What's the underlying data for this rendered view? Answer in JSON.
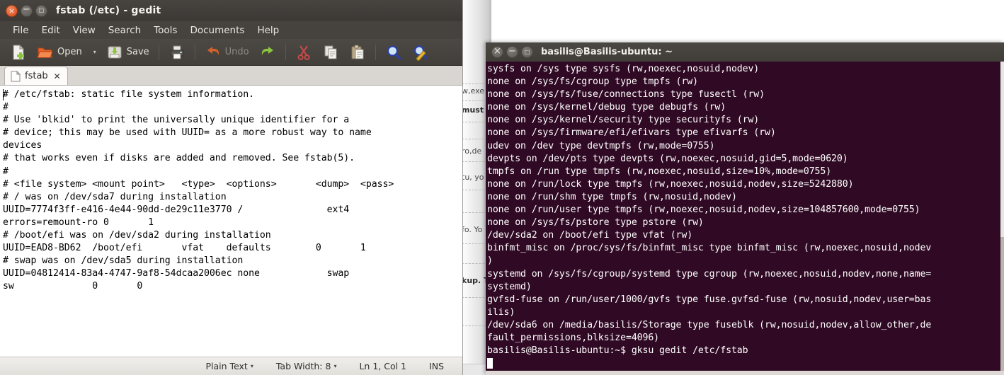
{
  "gedit": {
    "title": "fstab (/etc) - gedit",
    "window_buttons": [
      {
        "name": "close",
        "glyph": "×"
      },
      {
        "name": "minimize",
        "glyph": "−"
      },
      {
        "name": "maximize",
        "glyph": "□"
      }
    ],
    "menu": [
      "File",
      "Edit",
      "View",
      "Search",
      "Tools",
      "Documents",
      "Help"
    ],
    "toolbar": {
      "new_label": "",
      "open_label": "Open",
      "open_dropdown": "▾",
      "save_label": "Save",
      "print_label": "",
      "undo_label": "Undo",
      "redo_label": "",
      "cut_label": "",
      "copy_label": "",
      "paste_label": "",
      "find_label": "",
      "replace_label": ""
    },
    "tab": {
      "label": "fstab",
      "close": "✕"
    },
    "document_text": "# /etc/fstab: static file system information.\n#\n# Use 'blkid' to print the universally unique identifier for a\n# device; this may be used with UUID= as a more robust way to name\ndevices\n# that works even if disks are added and removed. See fstab(5).\n#\n# <file system> <mount point>   <type>  <options>       <dump>  <pass>\n# / was on /dev/sda7 during installation\nUUID=7774f3ff-e416-4e44-90dd-de29c11e3770 /               ext4\nerrors=remount-ro 0       1\n# /boot/efi was on /dev/sda2 during installation\nUUID=EAD8-BD62  /boot/efi       vfat    defaults        0       1\n# swap was on /dev/sda5 during installation\nUUID=04812414-83a4-4747-9af8-54dcaa2006ec none            swap\nsw              0       0",
    "statusbar": {
      "language": "Plain Text",
      "language_arrow": "▾",
      "tab_width": "Tab Width: 8",
      "tab_width_arrow": "▾",
      "position": "Ln 1, Col 1",
      "mode": "INS"
    }
  },
  "terminal": {
    "title": "basilis@Basilis-ubuntu: ~",
    "window_buttons": [
      {
        "name": "close",
        "glyph": "×"
      },
      {
        "name": "minimize",
        "glyph": "−"
      },
      {
        "name": "maximize",
        "glyph": "□"
      }
    ],
    "output": "sysfs on /sys type sysfs (rw,noexec,nosuid,nodev)\nnone on /sys/fs/cgroup type tmpfs (rw)\nnone on /sys/fs/fuse/connections type fusectl (rw)\nnone on /sys/kernel/debug type debugfs (rw)\nnone on /sys/kernel/security type securityfs (rw)\nnone on /sys/firmware/efi/efivars type efivarfs (rw)\nudev on /dev type devtmpfs (rw,mode=0755)\ndevpts on /dev/pts type devpts (rw,noexec,nosuid,gid=5,mode=0620)\ntmpfs on /run type tmpfs (rw,noexec,nosuid,size=10%,mode=0755)\nnone on /run/lock type tmpfs (rw,noexec,nosuid,nodev,size=5242880)\nnone on /run/shm type tmpfs (rw,nosuid,nodev)\nnone on /run/user type tmpfs (rw,noexec,nosuid,nodev,size=104857600,mode=0755)\nnone on /sys/fs/pstore type pstore (rw)\n/dev/sda2 on /boot/efi type vfat (rw)\nbinfmt_misc on /proc/sys/fs/binfmt_misc type binfmt_misc (rw,noexec,nosuid,nodev\n)\nsystemd on /sys/fs/cgroup/systemd type cgroup (rw,noexec,nosuid,nodev,none,name=\nsystemd)\ngvfsd-fuse on /run/user/1000/gvfs type fuse.gvfsd-fuse (rw,nosuid,nodev,user=bas\nilis)\n/dev/sda6 on /media/basilis/Storage type fuseblk (rw,nosuid,nodev,allow_other,de\nfault_permissions,blksize=4096)",
    "prompt": "basilis@Basilis-ubuntu:~$ ",
    "command": "gksu gedit /etc/fstab"
  },
  "background_window": {
    "fragments": [
      "w,exe",
      "must d",
      "ro,de",
      "tu, yo",
      "fo. Yo",
      "kup. T"
    ]
  },
  "colors": {
    "terminal_bg": "#300a24",
    "titlebar": "#46433e",
    "close_button": "#d6481d",
    "editor_bg": "#ffffff"
  }
}
